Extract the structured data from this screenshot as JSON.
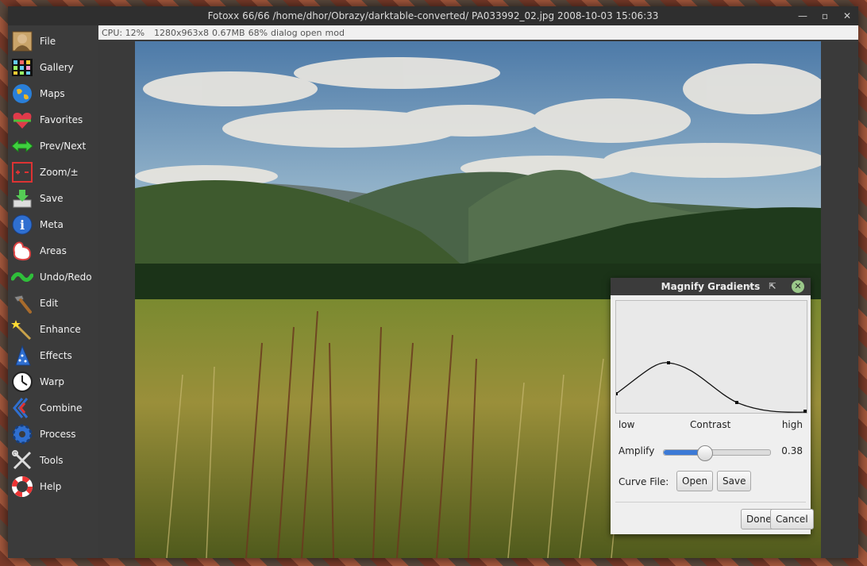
{
  "window": {
    "title": "Fotoxx   66/66  /home/dhor/Obrazy/darktable-converted/  PA033992_02.jpg  2008-10-03 15:06:33",
    "controls": [
      "minimize-icon",
      "restore-icon",
      "close-icon"
    ]
  },
  "statusbar": {
    "cpu": "CPU: 12%",
    "dims": "1280x963x8",
    "size": "0.67MB",
    "zoom": "68%",
    "state": "dialog open",
    "mod": "mod"
  },
  "sidebar": {
    "items": [
      {
        "label": "File",
        "icon": "portrait-icon"
      },
      {
        "label": "Gallery",
        "icon": "grid-icon"
      },
      {
        "label": "Maps",
        "icon": "globe-icon"
      },
      {
        "label": "Favorites",
        "icon": "heart-icon"
      },
      {
        "label": "Prev/Next",
        "icon": "double-arrow-icon"
      },
      {
        "label": "Zoom/±",
        "icon": "zoom-icon"
      },
      {
        "label": "Save",
        "icon": "save-icon"
      },
      {
        "label": "Meta",
        "icon": "info-icon"
      },
      {
        "label": "Areas",
        "icon": "areas-icon"
      },
      {
        "label": "Undo/Redo",
        "icon": "undo-redo-icon"
      },
      {
        "label": "Edit",
        "icon": "hammer-icon"
      },
      {
        "label": "Enhance",
        "icon": "magic-wand-icon"
      },
      {
        "label": "Effects",
        "icon": "wizard-hat-icon"
      },
      {
        "label": "Warp",
        "icon": "clock-icon"
      },
      {
        "label": "Combine",
        "icon": "combine-icon"
      },
      {
        "label": "Process",
        "icon": "gear-icon"
      },
      {
        "label": "Tools",
        "icon": "tools-icon"
      },
      {
        "label": "Help",
        "icon": "lifebuoy-icon"
      }
    ]
  },
  "dialog": {
    "title": "Magnify Gradients",
    "axis": {
      "low": "low",
      "mid": "Contrast",
      "high": "high"
    },
    "amplify": {
      "label": "Amplify",
      "value": 0.38,
      "value_text": "0.38"
    },
    "curve_file": {
      "label": "Curve File:",
      "open": "Open",
      "save": "Save"
    },
    "done": "Done",
    "cancel": "Cancel"
  }
}
